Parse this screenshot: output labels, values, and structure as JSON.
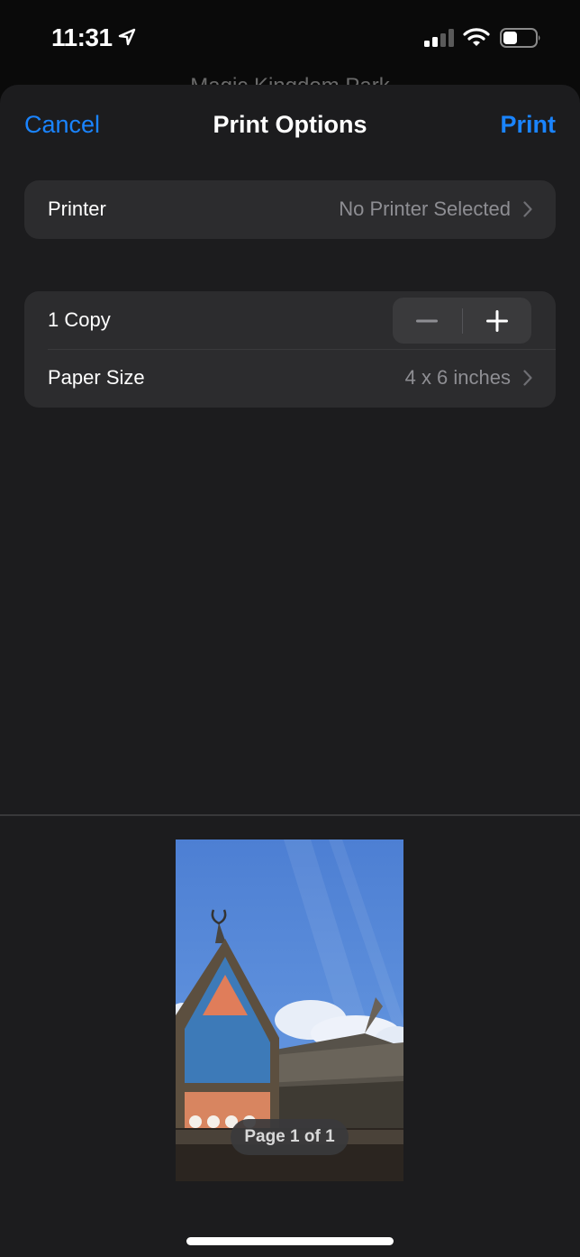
{
  "status_bar": {
    "time": "11:31",
    "location_icon": "location-arrow-icon",
    "signal_icon": "cellular-signal-icon",
    "signal_bars_active": 2,
    "signal_bars_total": 4,
    "wifi_icon": "wifi-icon",
    "battery_icon": "battery-icon",
    "battery_level": 0.4
  },
  "background": {
    "title": "Magic Kingdom Park"
  },
  "nav": {
    "cancel_label": "Cancel",
    "title": "Print Options",
    "print_label": "Print"
  },
  "printer": {
    "label": "Printer",
    "value": "No Printer Selected"
  },
  "copies": {
    "label": "1 Copy",
    "count": 1,
    "decrement_icon": "minus-icon",
    "increment_icon": "plus-icon"
  },
  "paper_size": {
    "label": "Paper Size",
    "value": "4 x 6 inches"
  },
  "preview": {
    "image_description": "Thatched-roof building with painted gable and horned animal statues against blue sky",
    "page_indicator": "Page 1 of 1"
  },
  "colors": {
    "accent": "#1a84ff",
    "sheet_background": "#1c1c1e",
    "group_background": "#2c2c2e",
    "secondary_text": "#8e8e93"
  }
}
